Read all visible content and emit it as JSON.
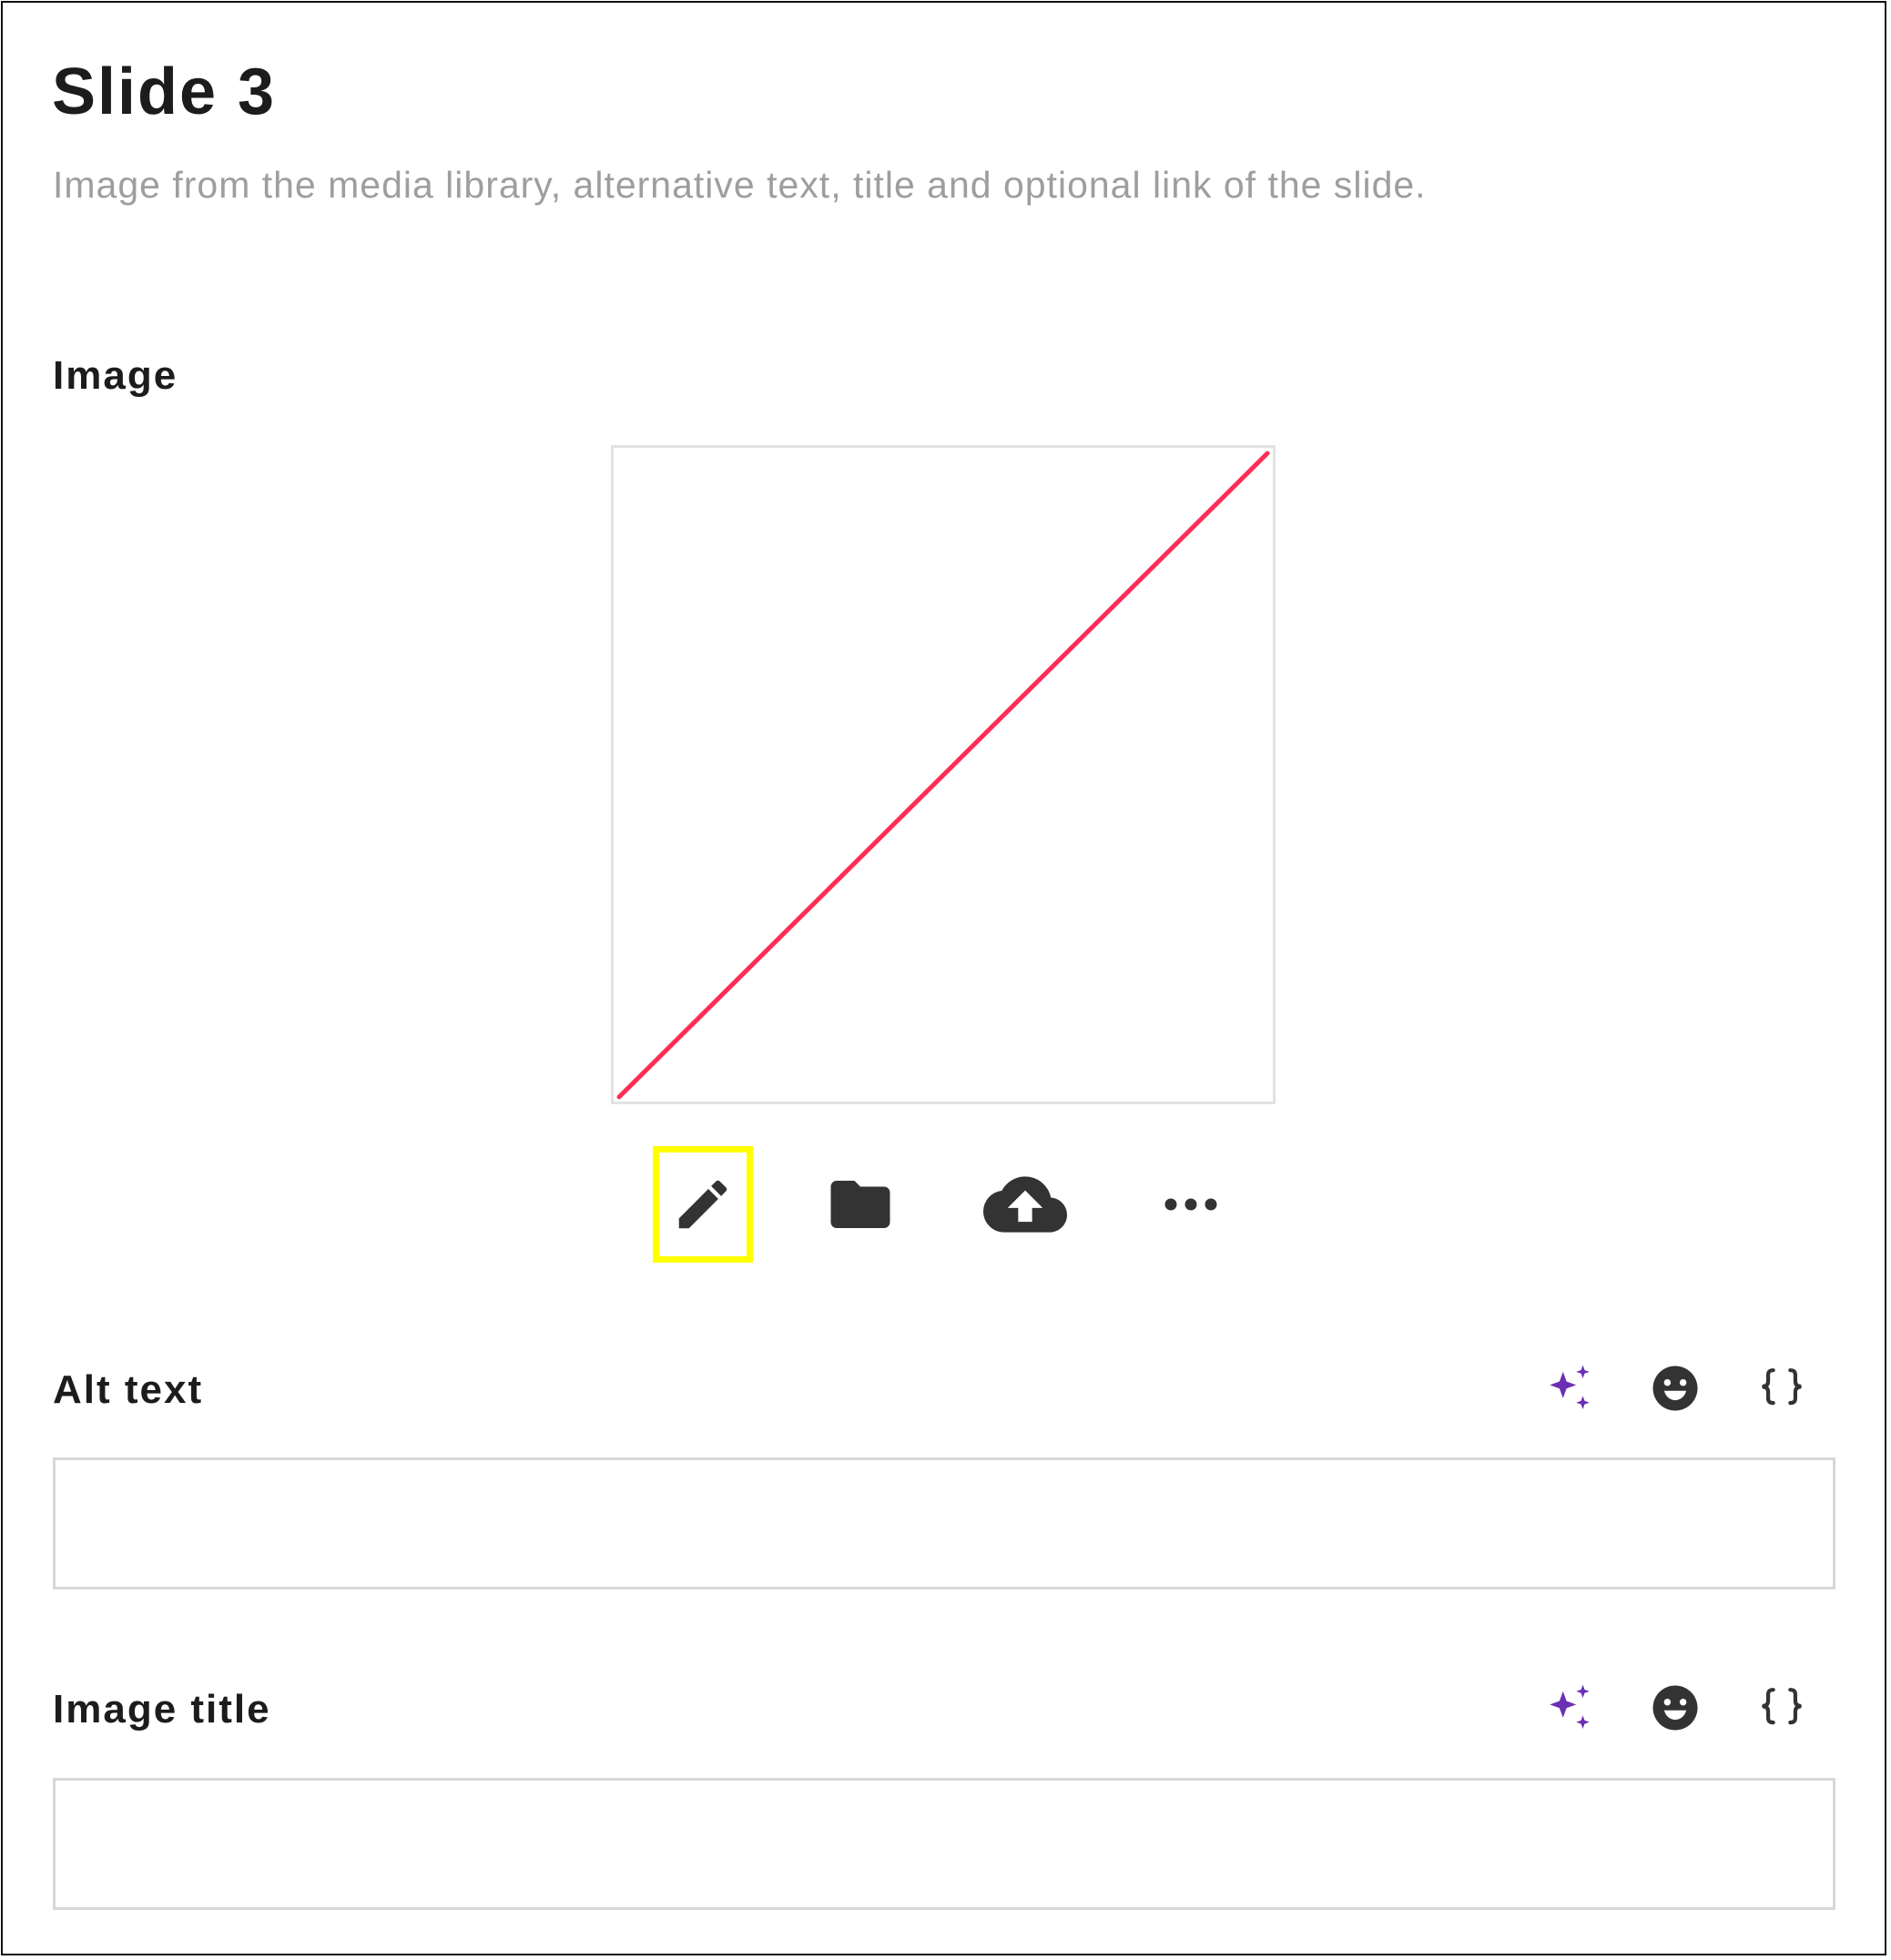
{
  "header": {
    "title": "Slide 3",
    "subtitle": "Image from the media library, alternative text, title and optional link of the slide."
  },
  "image_field": {
    "label": "Image",
    "preview": {
      "state": "empty-placeholder",
      "slash_color": "#ff2d55"
    },
    "toolbar": [
      {
        "icon": "pencil-icon",
        "action": "edit",
        "highlighted": true,
        "highlight_color": "#ffff00"
      },
      {
        "icon": "folder-icon",
        "action": "media-library"
      },
      {
        "icon": "cloud-upload-icon",
        "action": "upload"
      },
      {
        "icon": "more-horizontal-icon",
        "action": "more"
      }
    ]
  },
  "alt_text_field": {
    "label": "Alt text",
    "value": "",
    "tools": [
      "ai-sparkle-icon",
      "emoji-icon",
      "curly-braces-icon"
    ]
  },
  "image_title_field": {
    "label": "Image title",
    "value": "",
    "tools": [
      "ai-sparkle-icon",
      "emoji-icon",
      "curly-braces-icon"
    ]
  },
  "colors": {
    "ai_accent": "#6b2fb3",
    "icon": "#333333",
    "border": "#d7d7d7",
    "frame": "#111111"
  }
}
